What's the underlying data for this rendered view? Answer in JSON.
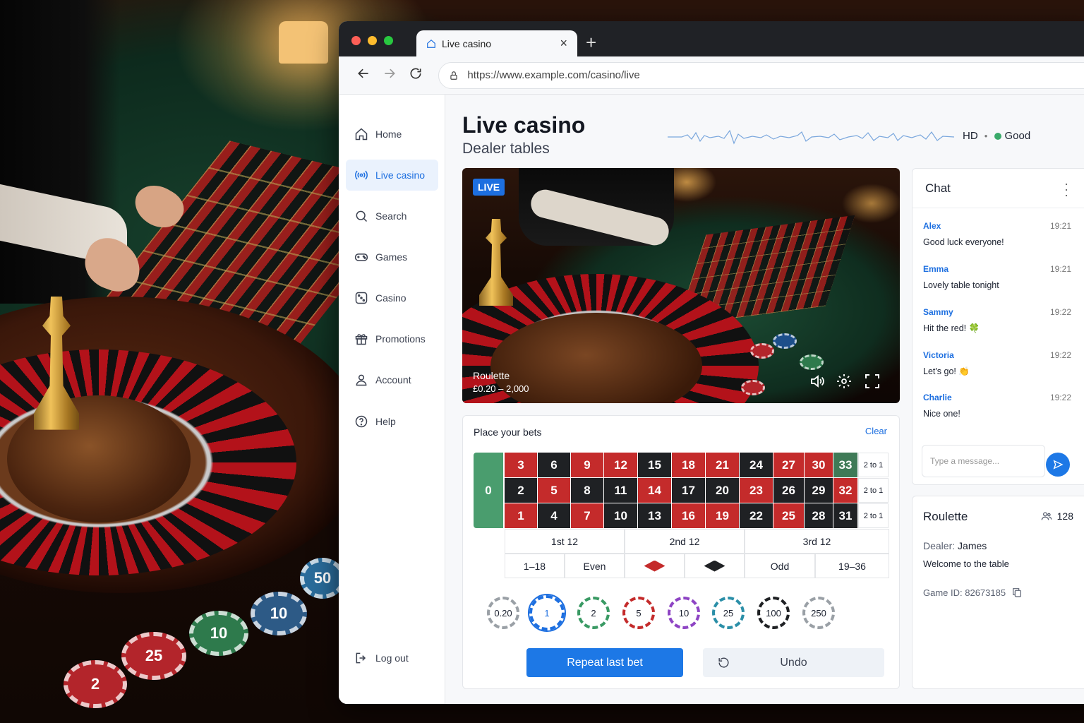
{
  "browser": {
    "tab_title": "Live casino",
    "tab_close": "×",
    "new_tab": "+",
    "url": "https://www.example.com/casino/live"
  },
  "sidebar": {
    "items": [
      {
        "label": "Home",
        "icon": "home-icon"
      },
      {
        "label": "Live casino",
        "icon": "broadcast-icon",
        "active": true
      },
      {
        "label": "Search",
        "icon": "search-icon"
      },
      {
        "label": "Games",
        "icon": "gamepad-icon"
      },
      {
        "label": "Casino",
        "icon": "dice-icon"
      },
      {
        "label": "Promotions",
        "icon": "gift-icon"
      },
      {
        "label": "Account",
        "icon": "user-icon"
      },
      {
        "label": "Help",
        "icon": "help-icon"
      }
    ],
    "logout": "Log out"
  },
  "header": {
    "title": "Live casino",
    "subtitle": "Dealer tables",
    "quality": "HD",
    "connection": "Good",
    "connection_color": "#3aaa6a"
  },
  "video": {
    "badge": "LIVE",
    "game": "Roulette",
    "limits": "£0.20 – 2,000"
  },
  "bets": {
    "title": "Place your bets",
    "clear": "Clear",
    "zero": "0",
    "rows": [
      [
        {
          "n": "3",
          "c": "red"
        },
        {
          "n": "6",
          "c": "black"
        },
        {
          "n": "9",
          "c": "red"
        },
        {
          "n": "12",
          "c": "red"
        },
        {
          "n": "15",
          "c": "black"
        },
        {
          "n": "18",
          "c": "red"
        },
        {
          "n": "21",
          "c": "red"
        },
        {
          "n": "24",
          "c": "black"
        },
        {
          "n": "27",
          "c": "red"
        },
        {
          "n": "30",
          "c": "red"
        },
        {
          "n": "33",
          "c": "green"
        }
      ],
      [
        {
          "n": "2",
          "c": "black"
        },
        {
          "n": "5",
          "c": "red"
        },
        {
          "n": "8",
          "c": "black"
        },
        {
          "n": "11",
          "c": "black"
        },
        {
          "n": "14",
          "c": "red"
        },
        {
          "n": "17",
          "c": "black"
        },
        {
          "n": "20",
          "c": "black"
        },
        {
          "n": "23",
          "c": "red"
        },
        {
          "n": "26",
          "c": "black"
        },
        {
          "n": "29",
          "c": "black"
        },
        {
          "n": "32",
          "c": "red"
        }
      ],
      [
        {
          "n": "1",
          "c": "red"
        },
        {
          "n": "4",
          "c": "black"
        },
        {
          "n": "7",
          "c": "red"
        },
        {
          "n": "10",
          "c": "black"
        },
        {
          "n": "13",
          "c": "black"
        },
        {
          "n": "16",
          "c": "red"
        },
        {
          "n": "19",
          "c": "red"
        },
        {
          "n": "22",
          "c": "black"
        },
        {
          "n": "25",
          "c": "red"
        },
        {
          "n": "28",
          "c": "black"
        },
        {
          "n": "31",
          "c": "black"
        }
      ]
    ],
    "column_bet": "2 to 1",
    "dozens": [
      "1st 12",
      "2nd 12",
      "3rd 12"
    ],
    "even_money": [
      "1–18",
      "Even",
      "",
      "",
      "Odd",
      "19–36"
    ],
    "chips": [
      {
        "value": "0.20",
        "color": "#9aa0a6"
      },
      {
        "value": "1",
        "color": "#1d6fe0",
        "selected": true
      },
      {
        "value": "2",
        "color": "#3a9a64"
      },
      {
        "value": "5",
        "color": "#c42b2b"
      },
      {
        "value": "10",
        "color": "#8e44c4"
      },
      {
        "value": "25",
        "color": "#2b8fa8"
      },
      {
        "value": "100",
        "color": "#1f2124"
      },
      {
        "value": "250",
        "color": "#9aa0a6"
      }
    ],
    "repeat": "Repeat last bet",
    "undo": "Undo"
  },
  "chat": {
    "title": "Chat",
    "messages": [
      {
        "user": "Alex",
        "time": "19:21",
        "text": "Good luck everyone!"
      },
      {
        "user": "Emma",
        "time": "19:21",
        "text": "Lovely table tonight"
      },
      {
        "user": "Sammy",
        "time": "19:22",
        "text": "Hit the red! 🍀"
      },
      {
        "user": "Victoria",
        "time": "19:22",
        "text": "Let's go! 👏"
      },
      {
        "user": "Charlie",
        "time": "19:22",
        "text": "Nice one!"
      }
    ],
    "placeholder": "Type a message..."
  },
  "table_info": {
    "game": "Roulette",
    "players": "128",
    "dealer_label": "Dealer:",
    "dealer_name": "James",
    "welcome": "Welcome to the table",
    "game_id": "Game ID: 82673185"
  },
  "background_chips": [
    "50",
    "10",
    "10",
    "25",
    "2"
  ]
}
